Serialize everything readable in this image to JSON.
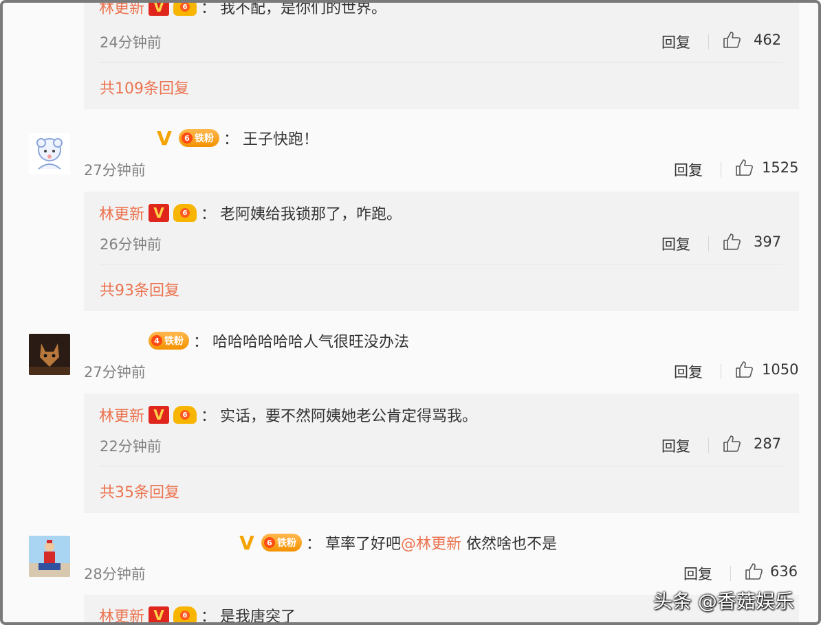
{
  "reply0": {
    "name": "林更新",
    "text": "我不配，是你们的世界。",
    "time": "24分钟前",
    "reply_label": "回复",
    "likes": "462"
  },
  "more0": "共109条回复",
  "comment1": {
    "fan_label": "铁粉",
    "fan_level": "6",
    "text": "王子快跑！",
    "time": "27分钟前",
    "reply_label": "回复",
    "likes": "1525"
  },
  "reply1": {
    "name": "林更新",
    "text": "老阿姨给我锁那了，咋跑。",
    "time": "26分钟前",
    "reply_label": "回复",
    "likes": "397"
  },
  "more1": "共93条回复",
  "comment2": {
    "fan_label": "铁粉",
    "fan_level": "4",
    "text": "哈哈哈哈哈哈人气很旺没办法",
    "time": "27分钟前",
    "reply_label": "回复",
    "likes": "1050"
  },
  "reply2": {
    "name": "林更新",
    "text": "实话，要不然阿姨她老公肯定得骂我。",
    "time": "22分钟前",
    "reply_label": "回复",
    "likes": "287"
  },
  "more2": "共35条回复",
  "comment3": {
    "fan_label": "铁粉",
    "fan_level": "6",
    "text_before": "草率了好吧",
    "mention": "@林更新",
    "text_after": " 依然啥也不是",
    "time": "28分钟前",
    "reply_label": "回复",
    "likes": "636"
  },
  "reply3": {
    "name": "林更新",
    "text": "是我唐突了"
  },
  "badges": {
    "v_mark": "V",
    "colon": "：",
    "crown_level": "6"
  },
  "watermark": "头条 @香菇娱乐",
  "colors": {
    "accent": "#eb7350",
    "reply_bg": "#f2f2f2",
    "vip_red": "#e0251c",
    "badge_orange": "#f39200"
  }
}
